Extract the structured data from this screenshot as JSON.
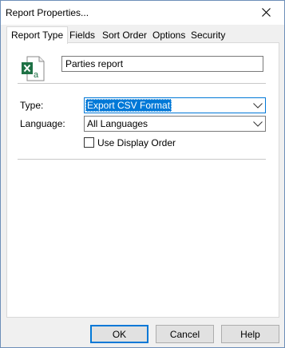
{
  "window": {
    "title": "Report Properties..."
  },
  "tabs": [
    {
      "label": "Report Type"
    },
    {
      "label": "Fields"
    },
    {
      "label": "Sort Order"
    },
    {
      "label": "Options"
    },
    {
      "label": "Security"
    }
  ],
  "report": {
    "name": "Parties report",
    "icon": "excel-file-icon"
  },
  "type": {
    "label": "Type:",
    "value": "Export CSV Format"
  },
  "language": {
    "label": "Language:",
    "value": "All Languages"
  },
  "display_order": {
    "label": "Use Display Order",
    "checked": false
  },
  "buttons": {
    "ok": "OK",
    "cancel": "Cancel",
    "help": "Help"
  },
  "colors": {
    "accent": "#0078d7",
    "excel_green": "#1e7145"
  }
}
